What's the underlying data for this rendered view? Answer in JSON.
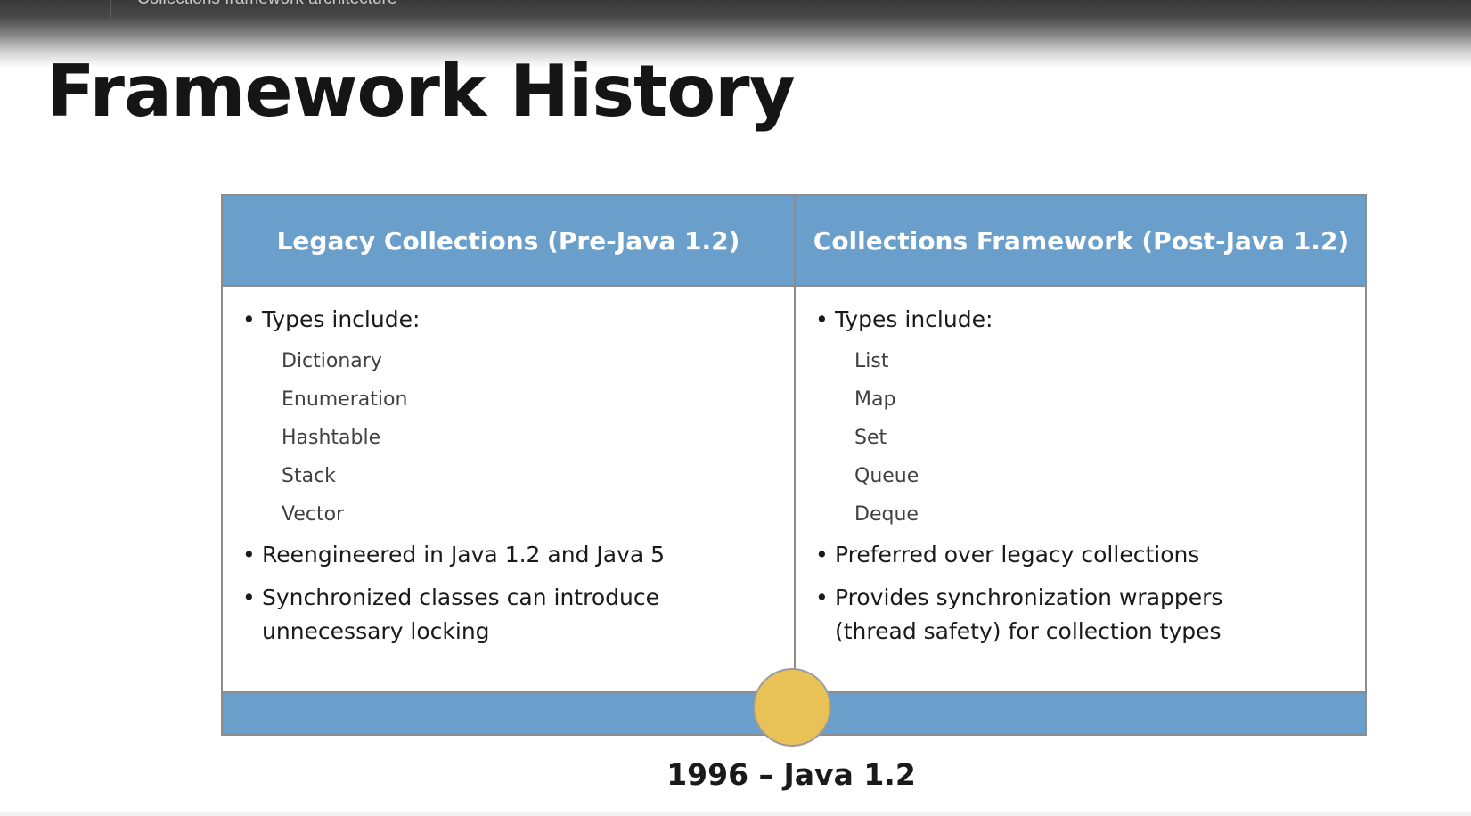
{
  "video": {
    "title": "Collections framework architecture"
  },
  "slide": {
    "title": "Framework History",
    "columns": [
      {
        "header": "Legacy Collections (Pre-Java 1.2)",
        "types_label": "Types include:",
        "types": [
          "Dictionary",
          "Enumeration",
          "Hashtable",
          "Stack",
          "Vector"
        ],
        "bullets": [
          [
            "Reengineered in Java 1.2 and Java 5"
          ],
          [
            "Synchronized classes can introduce",
            "unnecessary locking"
          ]
        ]
      },
      {
        "header": "Collections Framework (Post-Java 1.2)",
        "types_label": "Types include:",
        "types": [
          "List",
          "Map",
          "Set",
          "Queue",
          "Deque"
        ],
        "bullets": [
          [
            "Preferred over legacy collections"
          ],
          [
            "Provides synchronization wrappers",
            "(thread safety) for collection types"
          ]
        ]
      }
    ],
    "milestone": "1996 – Java 1.2",
    "bullet_char": "•",
    "colors": {
      "header_blue": "#6a9fcc",
      "milestone_gold": "#e9c257",
      "border_gray": "#8c8c8c"
    }
  }
}
